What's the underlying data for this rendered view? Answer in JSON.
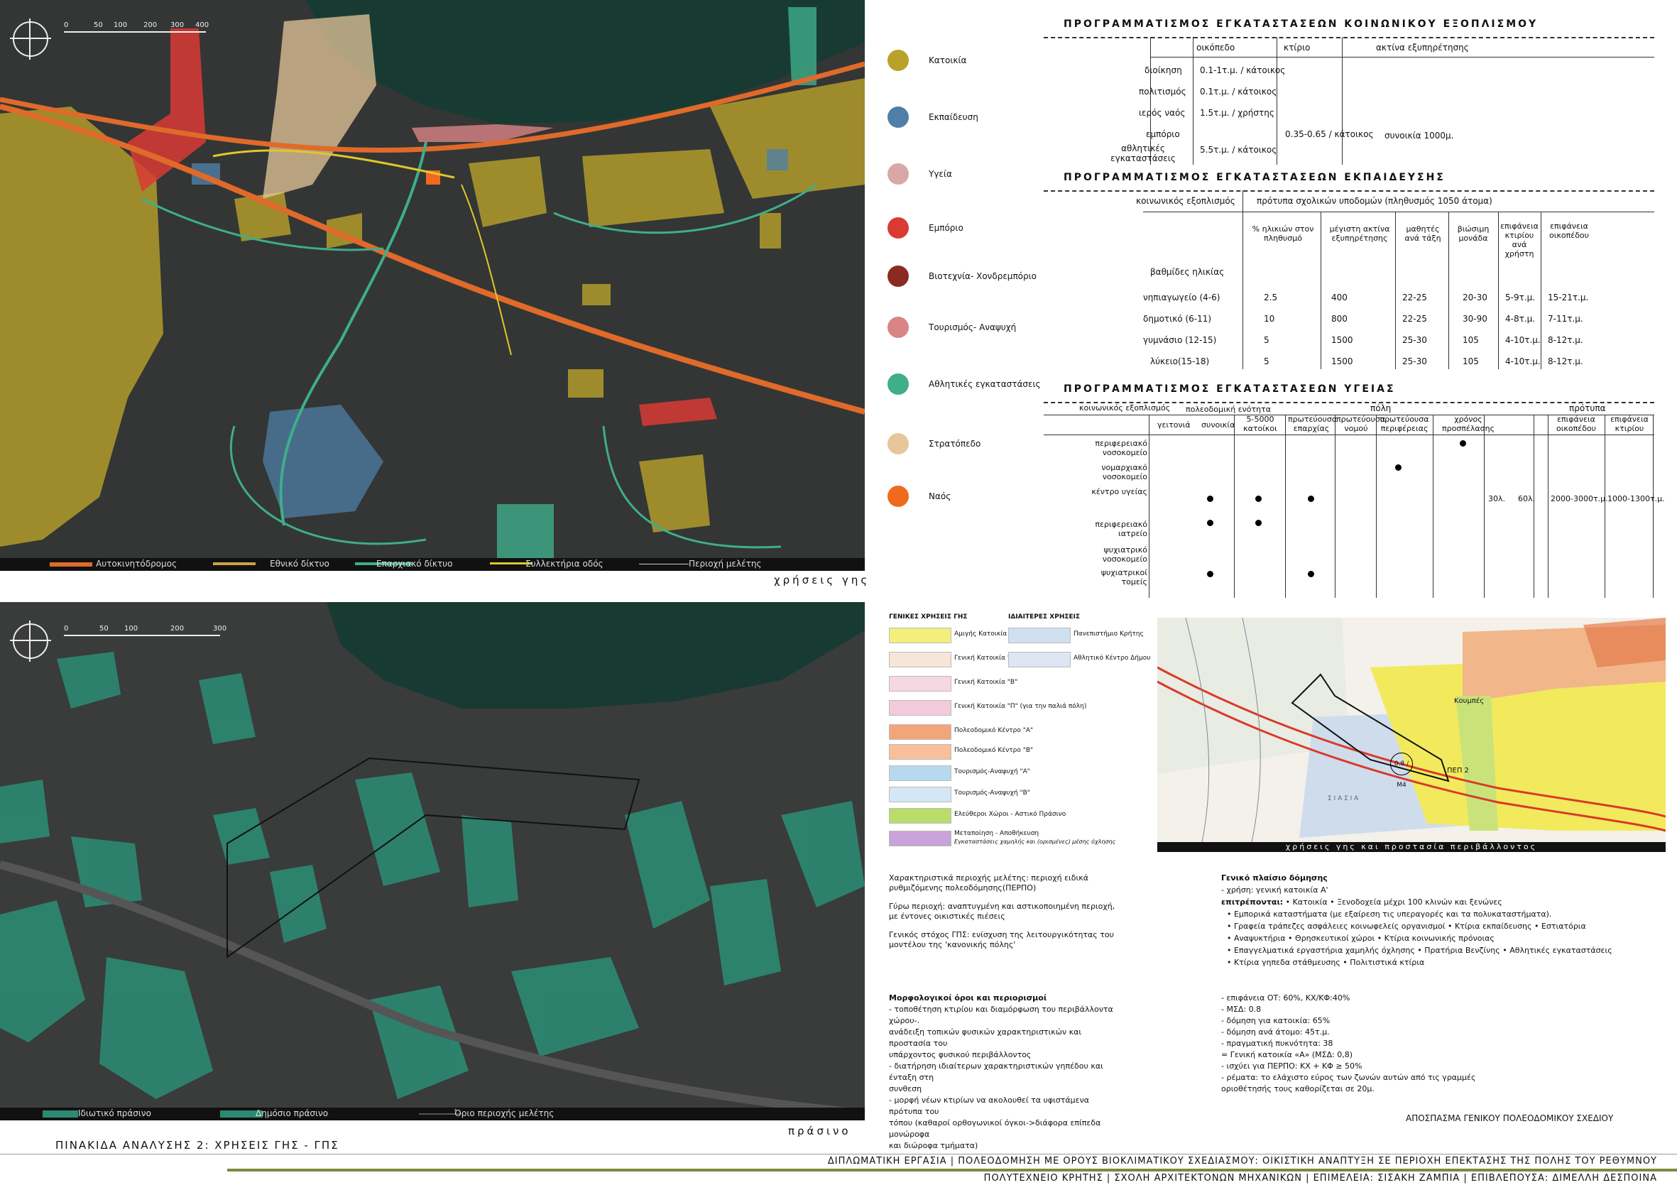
{
  "map1": {
    "scale_ticks": [
      "0",
      "50",
      "100",
      "200",
      "300",
      "400"
    ],
    "caption": "χρήσεις γης",
    "bottom_legend": [
      "Αυτοκινητόδρομος",
      "Εθνικό δίκτυο",
      "Επαρχιακό δίκτυο",
      "Συλλεκτήρια οδός",
      "Περιοχή μελέτης"
    ]
  },
  "landuse_legend": [
    {
      "label": "Κατοικία",
      "color": "#b9a22a"
    },
    {
      "label": "Εκπαίδευση",
      "color": "#4f7fa6"
    },
    {
      "label": "Υγεία",
      "color": "#d9a7a7"
    },
    {
      "label": "Εμπόριο",
      "color": "#d93a34"
    },
    {
      "label": "Βιοτεχνία- Χονδρεμπόριο",
      "color": "#8b2a22"
    },
    {
      "label": "Τουρισμός- Αναψυχή",
      "color": "#d98585"
    },
    {
      "label": "Αθλητικές εγκαταστάσεις",
      "color": "#3fae8a"
    },
    {
      "label": "Στρατόπεδο",
      "color": "#e6c79a"
    },
    {
      "label": "Ναός",
      "color": "#ef6a1e"
    }
  ],
  "table1": {
    "title": "ΠΡΟΓΡΑΜΜΑΤΙΣΜΟΣ ΕΓΚΑΤΑΣΤΑΣΕΩΝ ΚΟΙΝΩΝΙΚΟΥ ΕΞΟΠΛΙΣΜΟΥ",
    "headers": [
      "οικόπεδο",
      "κτίριο",
      "ακτίνα εξυπηρέτησης"
    ],
    "rows": [
      {
        "name": "διοίκηση",
        "plot": "0.1-1τ.μ. / κάτοικος"
      },
      {
        "name": "πολιτισμός",
        "plot": "0.1τ.μ. / κάτοικος"
      },
      {
        "name": "ιερός ναός",
        "plot": "1.5τ.μ. / χρήστης"
      },
      {
        "name": "εμπόριο",
        "plot": ""
      },
      {
        "name": "αθλητικές εγκαταστάσεις",
        "plot": "5.5τ.μ. / κάτοικος"
      }
    ],
    "building": "0.35-0.65 / κάτοικος",
    "radius": "συνοικία 1000μ."
  },
  "table2": {
    "title": "ΠΡΟΓΡΑΜΜΑΤΙΣΜΟΣ ΕΓΚΑΤΑΣΤΑΣΕΩΝ ΕΚΠΑΙΔΕΥΣΗΣ",
    "top_left": "κοινωνικός εξοπλισμός",
    "top_right": "πρότυπα σχολικών υποδομών (πληθυσμός 1050 άτομα)",
    "headers": [
      "% ηλικιών στον πληθυσμό",
      "μέγιστη ακτίνα εξυπηρέτησης",
      "μαθητές ανά τάξη",
      "βιώσιμη μονάδα",
      "επιφάνεια κτιρίου ανά χρήστη",
      "επιφάνεια οικοπέδου"
    ],
    "levels_label": "βαθμίδες ηλικίας",
    "rows": [
      {
        "name": "νηπιαγωγείο (4-6)",
        "v": [
          "2.5",
          "400",
          "22-25",
          "20-30",
          "5-9τ.μ.",
          "15-21τ.μ."
        ]
      },
      {
        "name": "δημοτικό (6-11)",
        "v": [
          "10",
          "800",
          "22-25",
          "30-90",
          "4-8τ.μ.",
          "7-11τ.μ."
        ]
      },
      {
        "name": "γυμνάσιο (12-15)",
        "v": [
          "5",
          "1500",
          "25-30",
          "105",
          "4-10τ.μ.",
          "8-12τ.μ."
        ]
      },
      {
        "name": "λύκειο(15-18)",
        "v": [
          "5",
          "1500",
          "25-30",
          "105",
          "4-10τ.μ.",
          "8-12τ.μ."
        ]
      }
    ]
  },
  "table3": {
    "title": "ΠΡΟΓΡΑΜΜΑΤΙΣΜΟΣ ΕΓΚΑΤΑΣΤΑΣΕΩΝ ΥΓΕΙΑΣ",
    "group_city": "πόλη",
    "group_norms": "πρότυπα",
    "first_col": "κοινωνικός εξοπλισμός",
    "unit_label": "πολεοδομική ενότητα",
    "headers": [
      "γειτονιά",
      "συνοικία",
      "5-5000 κατοίκοι",
      "πρωτεύουσα επαρχίας",
      "πρωτεύουσα νομού",
      "πρωτεύουσα περιφέρειας",
      "χρόνος προσπέλασης",
      "",
      "επιφάνεια οικοπέδου",
      "επιφάνεια κτιρίου"
    ],
    "rows": [
      "περιφερειακό νοσοκομείο",
      "νομαρχιακό νοσοκομείο",
      "κέντρο υγείας",
      "περιφερειακό ιατρείο",
      "ψυχιατρικό νοσοκομείο",
      "ψυχιατρικοί τομείς"
    ],
    "health_center": [
      "30λ.",
      "60λ.",
      "2000-3000τ.μ.",
      "1000-1300τ.μ."
    ]
  },
  "map2": {
    "scale_ticks": [
      "0",
      "50",
      "100",
      "200",
      "300"
    ],
    "caption": "πράσινο",
    "bottom_legend": [
      "Ιδιωτικό πράσινο",
      "Δημόσιο πράσινο",
      "Όριο περιοχής μελέτης"
    ]
  },
  "gps_legend": {
    "general_title": "ΓΕΝΙΚΕΣ ΧΡΗΣΕΙΣ ΓΗΣ",
    "special_title": "ΙΔΙΑΙΤΕΡΕΣ ΧΡΗΣΕΙΣ",
    "general": [
      {
        "label": "Αμιγής Κατοικία",
        "color": "#f4ee7a"
      },
      {
        "label": "Γενική Κατοικία \"Α\"",
        "color": "#f6e6d8"
      },
      {
        "label": "Γενική Κατοικία \"Β\"",
        "color": "#f6d8e2"
      },
      {
        "label": "Γενική Κατοικία \"Π\" (για την παλιά πόλη)",
        "color": "#f3c9dc"
      },
      {
        "label": "Πολεοδομικό Κέντρο \"Α\"",
        "color": "#f2a57a"
      },
      {
        "label": "Πολεοδομικό Κέντρο \"Β\"",
        "color": "#f7c09a"
      },
      {
        "label": "Τουρισμός-Αναψυχή \"Α\"",
        "color": "#b8d8f0"
      },
      {
        "label": "Τουρισμός-Αναψυχή \"Β\"",
        "color": "#d5e7f5"
      },
      {
        "label": "Ελεύθεροι Χώροι - Αστικό Πράσινο",
        "color": "#b9dc6a"
      },
      {
        "label": "Μεταποίηση - Αποθήκευση",
        "color": "#c9a2d8"
      }
    ],
    "storage_note": "Εγκαταστάσεις χαμηλής και (ορισμένες) μέσης όχλησης",
    "special": [
      {
        "label": "Πανεπιστήμιο Κρήτης",
        "color": "#cfe0f0"
      },
      {
        "label": "Αθλητικό Κέντρο Δήμου",
        "color": "#dde6f2"
      }
    ]
  },
  "notes": [
    "Χαρακτηριστικά περιοχής μελέτης: περιοχή ειδικά ρυθμιζόμενης πολεοδόμησης(ΠΕΡΠΟ)",
    "Γύρω περιοχή: αναπτυγμένη και αστικοποιημένη περιοχή, με έντονες οικιστικές πιέσεις",
    "Γενικός στόχος ΓΠΣ: ενίσχυση της λειτουργικότητας του μοντέλου της 'κανονικής πόλης'"
  ],
  "morpho": {
    "title": "Μορφολογικοί όροι και περιορισμοί",
    "lines": [
      "- τοποθέτηση κτιρίου  και διαμόρφωση του περιβάλλοντα χώρου-.",
      "ανάδειξη τοπικών φυσικών χαρακτηριστικών και προστασία του",
      "υπάρχοντος φυσικού περιβάλλοντος",
      "- διατήρηση ιδιαίτερων χαρακτηριστικών γηπέδου και ένταξη στη",
      "συνθεση",
      "- μορφή νέων κτιρίων να ακολουθεί τα υφιστάμενα πρότυπα του",
      "τόπου (καθαροί ορθογωνικοί όγκοι->διάφορα επίπεδα μονώροφα",
      "και διώροφα τμήματα)"
    ]
  },
  "gps_map": {
    "caption": "χρήσεις γης και προστασία περιβάλλοντος",
    "label1": "Κουμπές",
    "label2": "ΠΕΠ 2",
    "label3": "0.8 / Μ4",
    "label4": "Σ Ι Α Σ Ι Α"
  },
  "framework": {
    "title": "Γενικό πλαίσιο δόμησης",
    "use": "- χρήση: γενική κατοικία Α'",
    "allowed_label": "επιτρέπονται:",
    "allowed_first": " • Κατοικία • Ξενοδοχεία μέχρι 100 κλινών και ξενώνες",
    "allowed": [
      "• Εμπορικά καταστήματα (με εξαίρεση τις υπεραγορές και τα πολυκαταστήματα).",
      "• Γραφεία τράπεζες ασφάλειες κοινωφελείς οργανισμοί • Κτίρια εκπαίδευσης • Εστιατόρια",
      "• Αναψυκτήρια • Θρησκευτικοί χώροι • Κτίρια κοινωνικής πρόνοιας",
      "• Επαγγελματικά εργαστήρια χαμηλής όχλησης • Πρατήρια Βενζίνης • Αθλητικές εγκαταστάσεις",
      "• Κτίρια γηπεδα στάθμευσης • Πολιτιστικά κτίρια"
    ],
    "params": [
      "- επιφάνεια ΟΤ: 60%, ΚΧ/ΚΦ:40%",
      "- ΜΣΔ: 0.8",
      "- δόμηση για κατοικία: 65%",
      "- δόμηση ανά άτομο: 45τ.μ.",
      "- πραγματική πυκνότητα: 38",
      "= Γενική κατοικία «Α» (ΜΣΔ: 0,8)",
      "- ισχύει για ΠΕΡΠΟ: ΚΧ + ΚΦ ≥ 50%",
      "- ρέματα: το ελάχιστο εύρος των ζωνών αυτών από τις γραμμές",
      "οριοθέτησής τους καθορίζεται σε 20μ."
    ],
    "bottom": "ΑΠΟΣΠΑΣΜΑ ΓΕΝΙΚΟΥ ΠΟΛΕΟΔΟΜΙΚΟΥ ΣΧΕΔΙΟΥ"
  },
  "footer": {
    "board": "ΠΙΝΑΚΙΔΑ ΑΝΑΛΥΣΗΣ 2: ΧΡΗΣΕΙΣ ΓΗΣ - ΓΠΣ",
    "line1": "ΔΙΠΛΩΜΑΤΙΚΗ ΕΡΓΑΣΙΑ  |  ΠΟΛΕΟΔΟΜΗΣΗ ΜΕ ΟΡΟΥΣ ΒΙΟΚΛΙΜΑΤΙΚΟΥ ΣΧΕΔΙΑΣΜΟΥ: ΟΙΚΙΣΤΙΚΗ ΑΝΑΠΤΥΞΗ ΣΕ ΠΕΡΙΟΧΗ ΕΠΕΚΤΑΣΗΣ ΤΗΣ ΠΟΛΗΣ ΤΟΥ ΡΕΘΥΜΝΟΥ",
    "line2": "ΠΟΛΥΤΕΧΝΕΙΟ ΚΡΗΤΗΣ  |  ΣΧΟΛΗ ΑΡΧΙΤΕΚΤΟΝΩΝ ΜΗΧΑΝΙΚΩΝ  |  ΕΠΙΜΕΛΕΙΑ: ΣΙΣΑΚΗ ΖΑΜΠΙΑ  |  ΕΠΙΒΛΕΠΟΥΣΑ: ΔΙΜΕΛΛΗ ΔΕΣΠΟΙΝΑ",
    "accent": "#7c8a3c"
  }
}
